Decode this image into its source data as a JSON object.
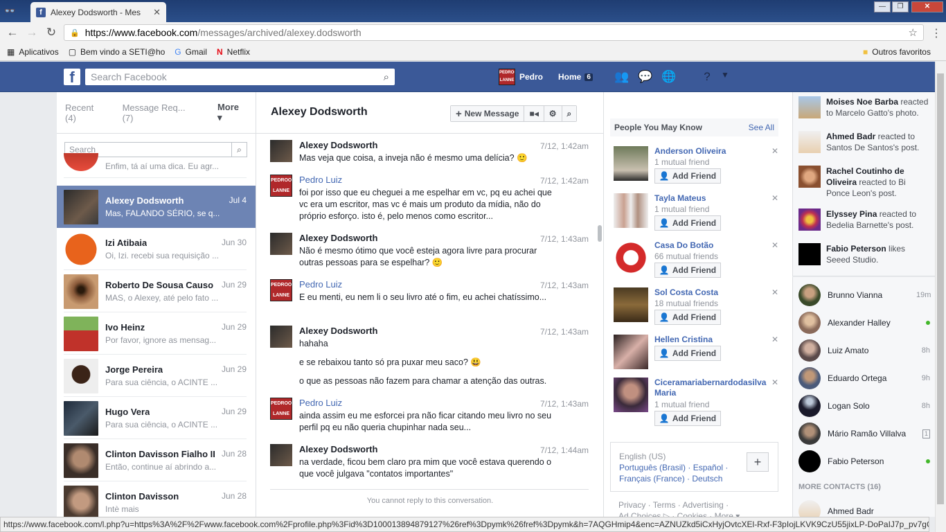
{
  "browser": {
    "tab_title": "Alexey Dodsworth - Mes",
    "url_host": "https://www.facebook.com",
    "url_path": "/messages/archived/alexey.dodsworth",
    "bookmarks": [
      "Aplicativos",
      "Bem vindo a SETI@ho",
      "Gmail",
      "Netflix"
    ],
    "other_bookmarks": "Outros favoritos",
    "status_url": "https://www.facebook.com/l.php?u=https%3A%2F%2Fwww.facebook.com%2Fprofile.php%3Fid%3D100013894879127%26ref%3Dpymk%26fref%3Dpymk&h=7AQGHmip4&enc=AZNUZkd5iCxHyjOvtcXEl-Rxf-F3pIojLKVK9CzU55jixLP-DoPaIJ7p_pv7gCsC..."
  },
  "fb": {
    "search_placeholder": "Search Facebook",
    "profile_name": "Pedro",
    "home_label": "Home",
    "home_count": "6",
    "avatar_text": "PEDROOM LANNE"
  },
  "left": {
    "tabs": [
      "Recent",
      "(4)",
      "Message Req...",
      "(7)"
    ],
    "more_label": "More",
    "search_placeholder": "Search",
    "threads": [
      {
        "name": "",
        "date": "",
        "snippet": "Enfim, tá aí uma dica. Eu agr..."
      },
      {
        "name": "Alexey Dodsworth",
        "date": "Jul 4",
        "snippet": "Mas, FALANDO SÉRIO, se q..."
      },
      {
        "name": "Izi Atibaia",
        "date": "Jun 30",
        "snippet": "Oi, Izi. recebi sua requisição ..."
      },
      {
        "name": "Roberto De Sousa Causo",
        "date": "Jun 29",
        "snippet": "MAS, o Alexey, até pelo fato ..."
      },
      {
        "name": "Ivo Heinz",
        "date": "Jun 29",
        "snippet": "Por favor, ignore as mensag..."
      },
      {
        "name": "Jorge Pereira",
        "date": "Jun 29",
        "snippet": "Para sua ciência, o ACINTE ..."
      },
      {
        "name": "Hugo Vera",
        "date": "Jun 29",
        "snippet": "Para sua ciência, o ACINTE ..."
      },
      {
        "name": "Clinton Davisson Fialho II",
        "date": "Jun 28",
        "snippet": "Então, continue aí abrindo a..."
      },
      {
        "name": "Clinton Davisson",
        "date": "Jun 28",
        "snippet": "Intè mais"
      }
    ]
  },
  "conv": {
    "title": "Alexey Dodsworth",
    "new_message": "New Message",
    "no_reply": "You cannot reply to this conversation.",
    "messages": [
      {
        "name": "Alexey Dodsworth",
        "time": "7/12, 1:42am",
        "lines": [
          "Mas veja que coisa, a inveja não é mesmo uma delícia? 🙂"
        ]
      },
      {
        "name": "Pedro Luiz",
        "time": "7/12, 1:42am",
        "lines": [
          "foi por isso que eu cheguei a me espelhar em vc, pq eu achei que vc era um escritor, mas vc é mais um produto da mídia, não do próprio esforço. isto é, pelo menos como escritor..."
        ]
      },
      {
        "name": "Alexey Dodsworth",
        "time": "7/12, 1:43am",
        "lines": [
          "Não é mesmo ótimo que você esteja agora livre para procurar outras pessoas para se espelhar? 🙂"
        ]
      },
      {
        "name": "Pedro Luiz",
        "time": "7/12, 1:43am",
        "lines": [
          "E eu menti, eu nem li o seu livro até o fim, eu achei chatíssimo..."
        ]
      },
      {
        "name": "Alexey Dodsworth",
        "time": "7/12, 1:43am",
        "lines": [
          "hahaha",
          "e se rebaixou tanto só pra puxar meu saco? 😃",
          "o que as pessoas não fazem para chamar a atenção das outras."
        ]
      },
      {
        "name": "Pedro Luiz",
        "time": "7/12, 1:43am",
        "lines": [
          "ainda assim eu me esforcei pra não ficar citando meu livro no seu perfil pq eu não queria chupinhar nada seu..."
        ]
      },
      {
        "name": "Alexey Dodsworth",
        "time": "7/12, 1:44am",
        "lines": [
          "na verdade, ficou bem claro pra mim que você estava querendo o que você julgava \"contatos importantes\""
        ]
      }
    ]
  },
  "pymk": {
    "title": "People You May Know",
    "see_all": "See All",
    "add_label": "Add Friend",
    "people": [
      {
        "name": "Anderson Oliveira",
        "mutual": "1 mutual friend"
      },
      {
        "name": "Tayla Mateus",
        "mutual": "1 mutual friend"
      },
      {
        "name": "Casa Do Botão",
        "mutual": "66 mutual friends"
      },
      {
        "name": "Sol Costa Costa",
        "mutual": "18 mutual friends"
      },
      {
        "name": "Hellen Cristina",
        "mutual": ""
      },
      {
        "name": "Ciceramariabernardodasilva Maria",
        "mutual": "1 mutual friend"
      }
    ]
  },
  "lang": {
    "current": "English (US)",
    "links_line1": "Português (Brasil) · Español ·",
    "links_line2": "Français (France) · Deutsch"
  },
  "footer": {
    "line1": "Privacy · Terms · Advertising ·",
    "line2": "Ad Choices ▷ · Cookies · More ▾"
  },
  "ticker": [
    {
      "name": "Moises Noe Barba",
      "text": " reacted to Marcelo Gatto's photo."
    },
    {
      "name": "Ahmed Badr",
      "text": " reacted to Santos De Santos's post."
    },
    {
      "name": "Rachel Coutinho de Oliveira",
      "text": " reacted to Bi Ponce Leon's post."
    },
    {
      "name": "Elyssey Pina",
      "text": " reacted to Bedelia Barnette's post."
    },
    {
      "name": "Fabio Peterson",
      "text": " likes Seeed Studio."
    }
  ],
  "chat": {
    "contacts": [
      {
        "name": "Brunno Vianna",
        "status": "19m"
      },
      {
        "name": "Alexander Halley",
        "status": "online"
      },
      {
        "name": "Luiz Amato",
        "status": "8h"
      },
      {
        "name": "Eduardo Ortega",
        "status": "9h"
      },
      {
        "name": "Logan Solo",
        "status": "8h"
      },
      {
        "name": "Mário Ramão Villalva",
        "status": "1"
      },
      {
        "name": "Fabio Peterson",
        "status": "online"
      }
    ],
    "more_contacts": "MORE CONTACTS (16)",
    "last_contact": "Ahmed Badr"
  }
}
